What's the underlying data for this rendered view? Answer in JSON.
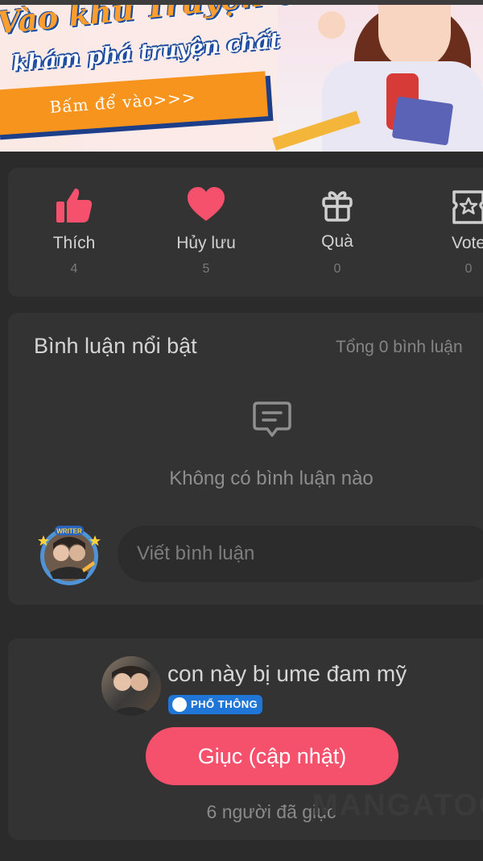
{
  "banner": {
    "title_line1": "Vào khu Truyện Chất,",
    "title_line2": "khám phá truyện chất",
    "cta": "Bấm để vào>>>"
  },
  "actions": [
    {
      "label": "Thích",
      "count": "4",
      "icon": "thumbs-up-icon",
      "color": "#f5506c"
    },
    {
      "label": "Hủy lưu",
      "count": "5",
      "icon": "heart-icon",
      "color": "#f5506c"
    },
    {
      "label": "Quà",
      "count": "0",
      "icon": "gift-icon",
      "color": "#cfcfcf"
    },
    {
      "label": "Vote",
      "count": "0",
      "icon": "ticket-star-icon",
      "color": "#cfcfcf"
    }
  ],
  "comments": {
    "title": "Bình luận nổi bật",
    "total": "Tổng 0 bình luận",
    "empty_text": "Không có bình luận nào",
    "input_placeholder": "Viết bình luận",
    "avatar_badge": "WRITER"
  },
  "author": {
    "name": "con này bị ume đam mỹ",
    "badge": "PHỔ THÔNG",
    "button": "Giục (cập nhật)",
    "urged_text": "6 người đã giục"
  },
  "watermark": "MANGATOO",
  "colors": {
    "accent": "#f5506c",
    "background": "#2b2b2b",
    "card": "#333333",
    "badge": "#1f76d6"
  }
}
